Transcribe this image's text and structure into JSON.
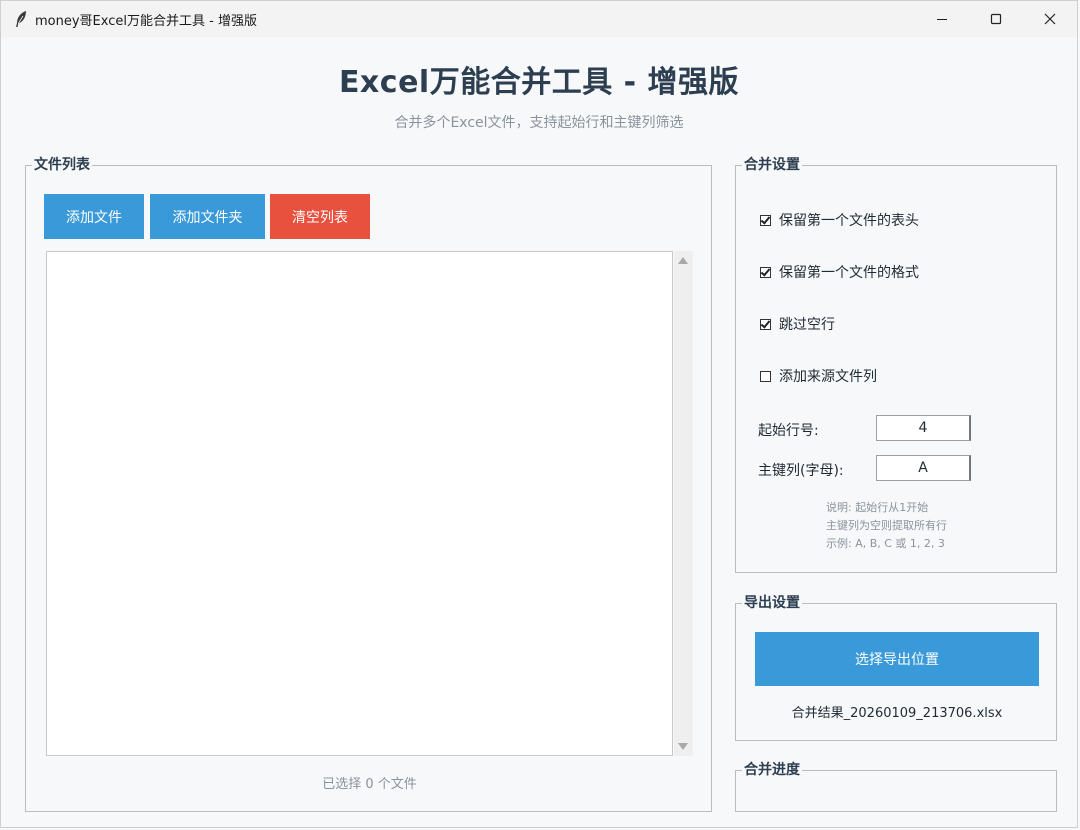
{
  "window": {
    "title": "money哥Excel万能合并工具 - 增强版"
  },
  "header": {
    "title": "Excel万能合并工具 - 增强版",
    "subtitle": "合并多个Excel文件，支持起始行和主键列筛选"
  },
  "file_list": {
    "label": "文件列表",
    "add_file_label": "添加文件",
    "add_folder_label": "添加文件夹",
    "clear_label": "清空列表",
    "selected_count": "已选择 0 个文件",
    "items": []
  },
  "merge_settings": {
    "label": "合并设置",
    "options": [
      {
        "label": "保留第一个文件的表头",
        "checked": true
      },
      {
        "label": "保留第一个文件的格式",
        "checked": true
      },
      {
        "label": "跳过空行",
        "checked": true
      },
      {
        "label": "添加来源文件列",
        "checked": false
      }
    ],
    "start_row_label": "起始行号:",
    "start_row_value": "4",
    "key_column_label": "主键列(字母):",
    "key_column_value": "A",
    "notes": [
      "说明: 起始行从1开始",
      "主键列为空则提取所有行",
      "示例: A, B, C 或 1, 2, 3"
    ]
  },
  "export_settings": {
    "label": "导出设置",
    "choose_location_label": "选择导出位置",
    "filename": "合并结果_20260109_213706.xlsx"
  },
  "progress": {
    "label": "合并进度"
  },
  "colors": {
    "primary_button": "#3a9ad9",
    "danger_button": "#e9513f",
    "title_text": "#2c3e50",
    "muted_text": "#8a939c"
  }
}
